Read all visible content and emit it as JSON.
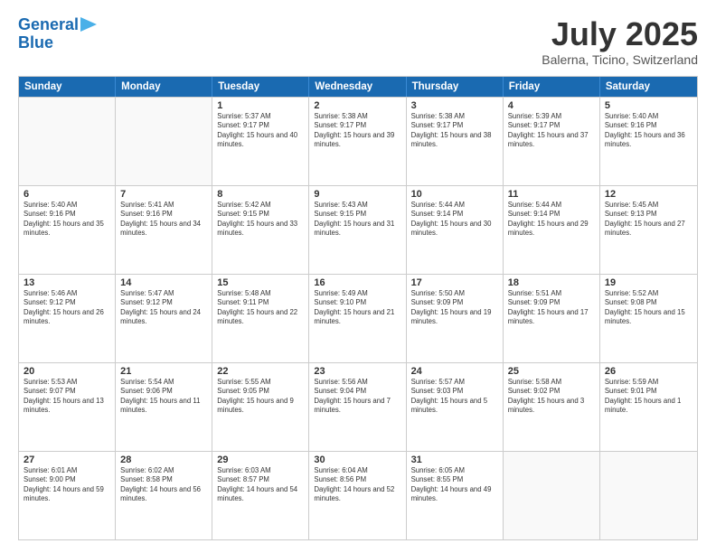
{
  "header": {
    "logo_line1": "General",
    "logo_line2": "Blue",
    "month_year": "July 2025",
    "location": "Balerna, Ticino, Switzerland"
  },
  "calendar": {
    "days_of_week": [
      "Sunday",
      "Monday",
      "Tuesday",
      "Wednesday",
      "Thursday",
      "Friday",
      "Saturday"
    ],
    "weeks": [
      [
        {
          "day": "",
          "empty": true
        },
        {
          "day": "",
          "empty": true
        },
        {
          "day": "1",
          "sunrise": "5:37 AM",
          "sunset": "9:17 PM",
          "daylight": "15 hours and 40 minutes."
        },
        {
          "day": "2",
          "sunrise": "5:38 AM",
          "sunset": "9:17 PM",
          "daylight": "15 hours and 39 minutes."
        },
        {
          "day": "3",
          "sunrise": "5:38 AM",
          "sunset": "9:17 PM",
          "daylight": "15 hours and 38 minutes."
        },
        {
          "day": "4",
          "sunrise": "5:39 AM",
          "sunset": "9:17 PM",
          "daylight": "15 hours and 37 minutes."
        },
        {
          "day": "5",
          "sunrise": "5:40 AM",
          "sunset": "9:16 PM",
          "daylight": "15 hours and 36 minutes."
        }
      ],
      [
        {
          "day": "6",
          "sunrise": "5:40 AM",
          "sunset": "9:16 PM",
          "daylight": "15 hours and 35 minutes."
        },
        {
          "day": "7",
          "sunrise": "5:41 AM",
          "sunset": "9:16 PM",
          "daylight": "15 hours and 34 minutes."
        },
        {
          "day": "8",
          "sunrise": "5:42 AM",
          "sunset": "9:15 PM",
          "daylight": "15 hours and 33 minutes."
        },
        {
          "day": "9",
          "sunrise": "5:43 AM",
          "sunset": "9:15 PM",
          "daylight": "15 hours and 31 minutes."
        },
        {
          "day": "10",
          "sunrise": "5:44 AM",
          "sunset": "9:14 PM",
          "daylight": "15 hours and 30 minutes."
        },
        {
          "day": "11",
          "sunrise": "5:44 AM",
          "sunset": "9:14 PM",
          "daylight": "15 hours and 29 minutes."
        },
        {
          "day": "12",
          "sunrise": "5:45 AM",
          "sunset": "9:13 PM",
          "daylight": "15 hours and 27 minutes."
        }
      ],
      [
        {
          "day": "13",
          "sunrise": "5:46 AM",
          "sunset": "9:12 PM",
          "daylight": "15 hours and 26 minutes."
        },
        {
          "day": "14",
          "sunrise": "5:47 AM",
          "sunset": "9:12 PM",
          "daylight": "15 hours and 24 minutes."
        },
        {
          "day": "15",
          "sunrise": "5:48 AM",
          "sunset": "9:11 PM",
          "daylight": "15 hours and 22 minutes."
        },
        {
          "day": "16",
          "sunrise": "5:49 AM",
          "sunset": "9:10 PM",
          "daylight": "15 hours and 21 minutes."
        },
        {
          "day": "17",
          "sunrise": "5:50 AM",
          "sunset": "9:09 PM",
          "daylight": "15 hours and 19 minutes."
        },
        {
          "day": "18",
          "sunrise": "5:51 AM",
          "sunset": "9:09 PM",
          "daylight": "15 hours and 17 minutes."
        },
        {
          "day": "19",
          "sunrise": "5:52 AM",
          "sunset": "9:08 PM",
          "daylight": "15 hours and 15 minutes."
        }
      ],
      [
        {
          "day": "20",
          "sunrise": "5:53 AM",
          "sunset": "9:07 PM",
          "daylight": "15 hours and 13 minutes."
        },
        {
          "day": "21",
          "sunrise": "5:54 AM",
          "sunset": "9:06 PM",
          "daylight": "15 hours and 11 minutes."
        },
        {
          "day": "22",
          "sunrise": "5:55 AM",
          "sunset": "9:05 PM",
          "daylight": "15 hours and 9 minutes."
        },
        {
          "day": "23",
          "sunrise": "5:56 AM",
          "sunset": "9:04 PM",
          "daylight": "15 hours and 7 minutes."
        },
        {
          "day": "24",
          "sunrise": "5:57 AM",
          "sunset": "9:03 PM",
          "daylight": "15 hours and 5 minutes."
        },
        {
          "day": "25",
          "sunrise": "5:58 AM",
          "sunset": "9:02 PM",
          "daylight": "15 hours and 3 minutes."
        },
        {
          "day": "26",
          "sunrise": "5:59 AM",
          "sunset": "9:01 PM",
          "daylight": "15 hours and 1 minute."
        }
      ],
      [
        {
          "day": "27",
          "sunrise": "6:01 AM",
          "sunset": "9:00 PM",
          "daylight": "14 hours and 59 minutes."
        },
        {
          "day": "28",
          "sunrise": "6:02 AM",
          "sunset": "8:58 PM",
          "daylight": "14 hours and 56 minutes."
        },
        {
          "day": "29",
          "sunrise": "6:03 AM",
          "sunset": "8:57 PM",
          "daylight": "14 hours and 54 minutes."
        },
        {
          "day": "30",
          "sunrise": "6:04 AM",
          "sunset": "8:56 PM",
          "daylight": "14 hours and 52 minutes."
        },
        {
          "day": "31",
          "sunrise": "6:05 AM",
          "sunset": "8:55 PM",
          "daylight": "14 hours and 49 minutes."
        },
        {
          "day": "",
          "empty": true
        },
        {
          "day": "",
          "empty": true
        }
      ]
    ]
  }
}
